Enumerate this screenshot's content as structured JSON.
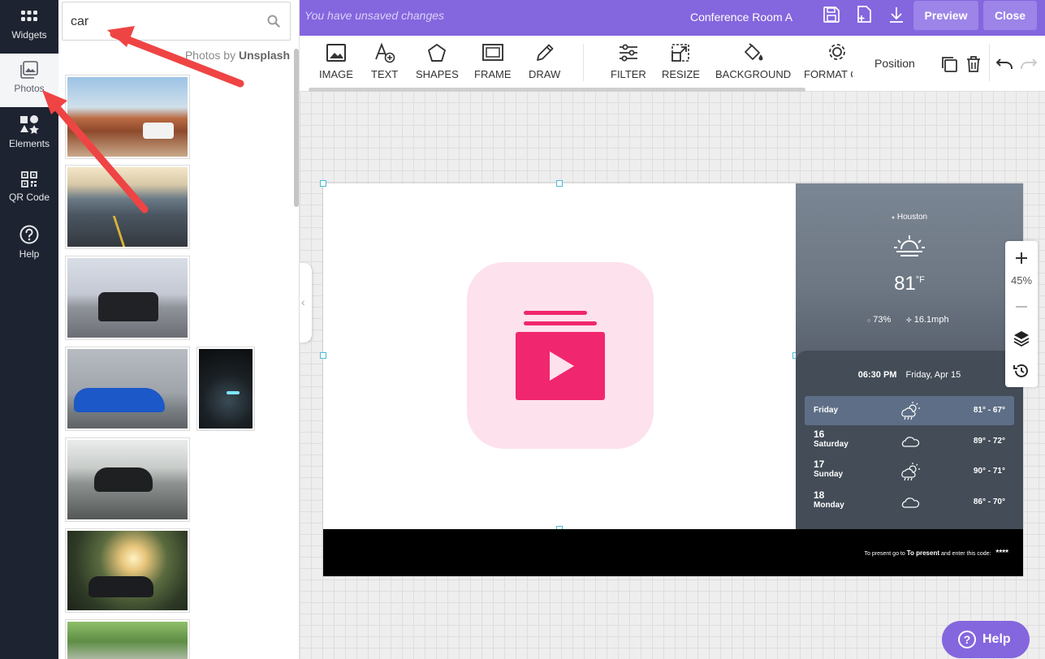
{
  "left_rail": {
    "items": [
      {
        "label": "Widgets",
        "icon": "grid-icon"
      },
      {
        "label": "Photos",
        "icon": "image-icon",
        "active": true
      },
      {
        "label": "Elements",
        "icon": "elements-icon"
      },
      {
        "label": "QR Code",
        "icon": "qr-code-icon"
      },
      {
        "label": "Help",
        "icon": "help-icon"
      }
    ]
  },
  "photos_panel": {
    "search_value": "car",
    "credit_prefix": "Photos by",
    "credit_source": "Unsplash",
    "thumbnails": [
      {
        "name": "white-suv-desert"
      },
      {
        "name": "car-on-winding-road"
      },
      {
        "name": "black-mustang"
      },
      {
        "name": "blue-bmw-coupe"
      },
      {
        "name": "car-headlight-dark"
      },
      {
        "name": "black-porsche-road"
      },
      {
        "name": "mustang-sunset"
      },
      {
        "name": "car-under-trees"
      }
    ]
  },
  "topbar": {
    "unsaved_text": "You have unsaved changes",
    "room_name": "Conference Room A",
    "preview_label": "Preview",
    "close_label": "Close"
  },
  "toolbar": {
    "tools": [
      {
        "label": "IMAGE",
        "icon": "image-icon"
      },
      {
        "label": "TEXT",
        "icon": "text-add-icon"
      },
      {
        "label": "SHAPES",
        "icon": "pentagon-icon"
      },
      {
        "label": "FRAME",
        "icon": "frame-icon"
      },
      {
        "label": "DRAW",
        "icon": "pencil-icon"
      },
      {
        "label": "FILTER",
        "icon": "sliders-icon"
      },
      {
        "label": "RESIZE",
        "icon": "resize-icon"
      },
      {
        "label": "BACKGROUND",
        "icon": "paint-bucket-icon"
      },
      {
        "label": "FORMAT C",
        "icon": "gear-icon"
      }
    ],
    "position_label": "Position"
  },
  "weather": {
    "city": "Houston",
    "temp": "81",
    "temp_unit": "°F",
    "humidity": "73%",
    "wind": "16.1mph",
    "time": "06:30 PM",
    "date": "Friday, Apr 15",
    "forecast": [
      {
        "num": "",
        "day": "Friday",
        "range": "81° - 67°",
        "icon": "storm-sun-icon"
      },
      {
        "num": "16",
        "day": "Saturday",
        "range": "89° - 72°",
        "icon": "cloud-icon"
      },
      {
        "num": "17",
        "day": "Sunday",
        "range": "90° - 71°",
        "icon": "storm-sun-icon"
      },
      {
        "num": "18",
        "day": "Monday",
        "range": "86° - 70°",
        "icon": "cloud-icon"
      }
    ]
  },
  "footer": {
    "text_prefix": "To present go to",
    "link": "To present",
    "text_suffix": "and enter this code:",
    "code": "****"
  },
  "zoom": {
    "level": "45%"
  },
  "help_button": {
    "label": "Help"
  },
  "colors": {
    "brand": "#8466de",
    "rail": "#1d2330",
    "app_icon_pink": "#f0266e",
    "annotation_arrow": "#ef4444"
  }
}
